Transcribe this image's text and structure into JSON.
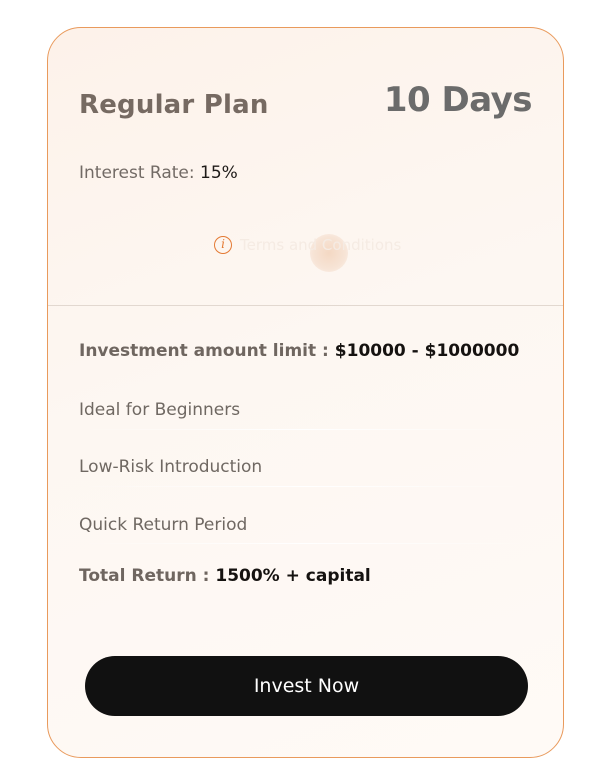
{
  "plan": {
    "title": "Regular Plan",
    "duration": "10 Days",
    "interest_label": "Interest Rate:",
    "interest_value": "15%",
    "terms_label": "Terms and Conditions",
    "info_icon": "info-icon",
    "investment_limit_label": "Investment amount limit",
    "investment_limit_separator": ":",
    "investment_limit_value": "$10000 - $1000000",
    "features": [
      "Ideal for Beginners",
      "Low-Risk Introduction",
      "Quick Return Period"
    ],
    "total_return_label": "Total Return",
    "total_return_separator": ":",
    "total_return_value": "1500% + capital",
    "cta_label": "Invest Now"
  },
  "colors": {
    "accent": "#e47a34",
    "card_border": "#e99a5c",
    "button_bg": "#111111",
    "button_text": "#ffffff"
  }
}
